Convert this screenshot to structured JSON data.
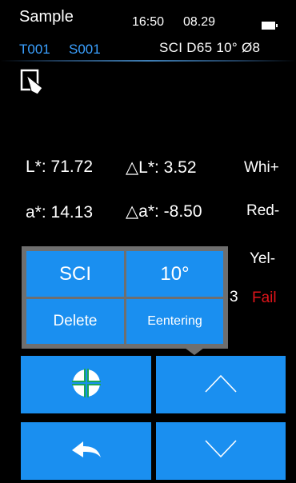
{
  "header": {
    "title": "Sample",
    "time": "16:50",
    "date": "08.29",
    "battery_icon": "battery-icon"
  },
  "info": {
    "test_id": "T001",
    "sample_id": "S001",
    "conditions": "SCI  D65  10°  Ø8"
  },
  "readings": {
    "L": "L*: 71.72",
    "dL": "△L*: 3.52",
    "white": "Whi+",
    "a": "a*: 14.13",
    "da": "△a*: -8.50",
    "red": "Red-",
    "yellow": "Yel-",
    "result": "Fail",
    "partial": "3"
  },
  "popup": {
    "sci": "SCI",
    "angle": "10°",
    "delete": "Delete",
    "entering": "Eentering"
  },
  "buttons": {
    "crosshair": "crosshair-icon",
    "up": "chevron-up-icon",
    "back": "back-arrow-icon",
    "down": "chevron-down-icon"
  },
  "colors": {
    "accent": "#1a8ff0",
    "id_text": "#3aa0ff",
    "fail": "#e1141a",
    "popup_bg": "#6f6f6f"
  }
}
